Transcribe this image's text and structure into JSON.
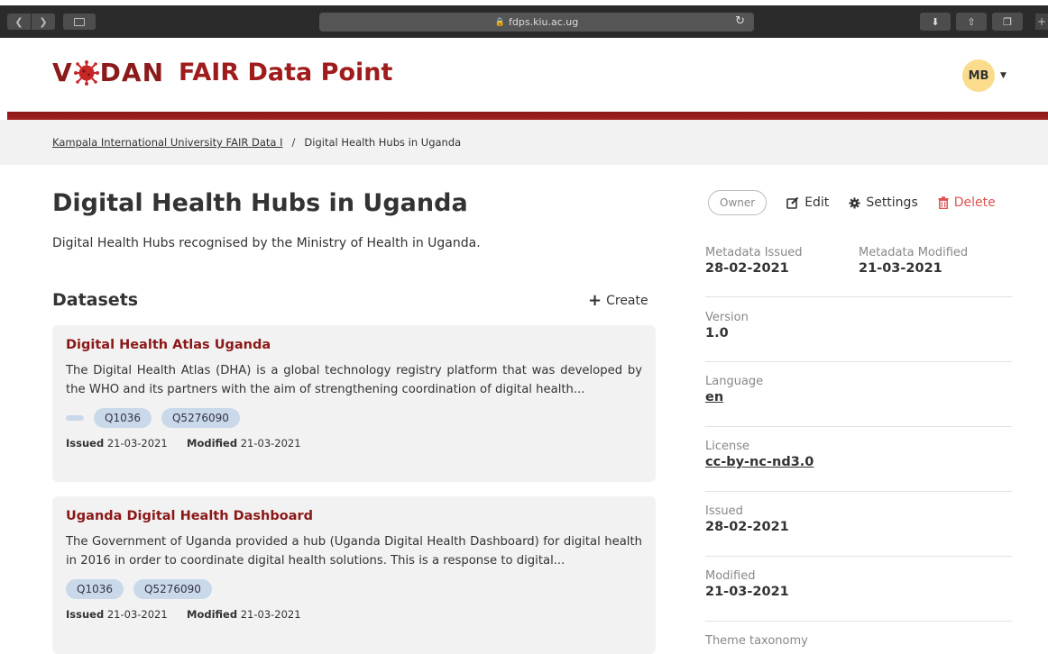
{
  "browser": {
    "url": "fdps.kiu.ac.ug",
    "back_icon": "chevron-left-icon",
    "forward_icon": "chevron-right-icon"
  },
  "header": {
    "logo_text_left": "V",
    "logo_text_right": "DAN",
    "app_title": "FAIR Data Point",
    "user_initials": "MB",
    "brand_color": "#8b1818",
    "avatar_color": "#fbdc8c"
  },
  "breadcrumb": {
    "parent": "Kampala International University FAIR Data I",
    "separator": "/",
    "current": "Digital Health Hubs in Uganda"
  },
  "catalog": {
    "title": "Digital Health Hubs in Uganda",
    "description": "Digital Health Hubs recognised by the Ministry of Health in Uganda."
  },
  "datasets": {
    "heading": "Datasets",
    "create_label": "Create",
    "items": [
      {
        "title": "Digital Health Atlas Uganda",
        "description": "The Digital Health Atlas (DHA) is a global technology registry platform that was developed by the WHO and its partners with the aim of strengthening coordination of digital health...",
        "tags": [
          "",
          "Q1036",
          "Q5276090"
        ],
        "issued_label": "Issued",
        "issued": "21-03-2021",
        "modified_label": "Modified",
        "modified": "21-03-2021"
      },
      {
        "title": "Uganda Digital Health Dashboard",
        "description": "The Government of Uganda provided a hub (Uganda Digital Health Dashboard) for digital health in 2016 in order to coordinate digital health solutions. This is a response to digital...",
        "tags": [
          "Q1036",
          "Q5276090"
        ],
        "issued_label": "Issued",
        "issued": "21-03-2021",
        "modified_label": "Modified",
        "modified": "21-03-2021"
      }
    ]
  },
  "actions": {
    "owner_badge": "Owner",
    "edit_label": "Edit",
    "settings_label": "Settings",
    "delete_label": "Delete",
    "delete_color": "#e05252"
  },
  "metadata": {
    "metadata_issued_label": "Metadata Issued",
    "metadata_issued": "28-02-2021",
    "metadata_modified_label": "Metadata Modified",
    "metadata_modified": "21-03-2021",
    "version_label": "Version",
    "version": "1.0",
    "language_label": "Language",
    "language": "en",
    "license_label": "License",
    "license": "cc-by-nc-nd3.0",
    "issued_label": "Issued",
    "issued": "28-02-2021",
    "modified_label": "Modified",
    "modified": "21-03-2021",
    "theme_taxonomy_label": "Theme taxonomy"
  }
}
